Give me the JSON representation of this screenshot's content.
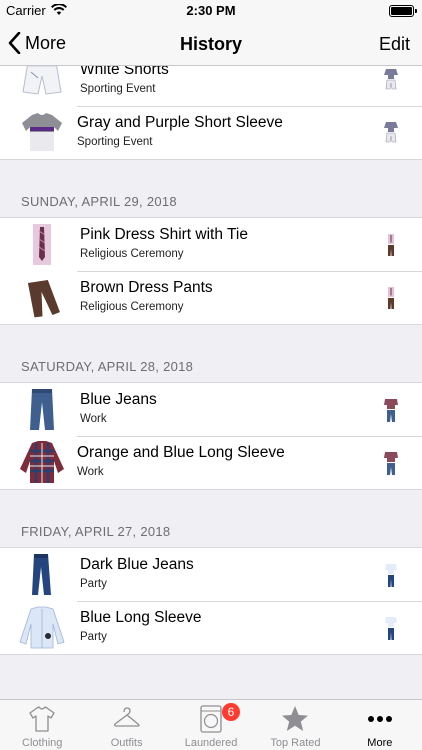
{
  "status_bar": {
    "carrier": "Carrier",
    "time": "2:30 PM"
  },
  "nav": {
    "back_label": "More",
    "title": "History",
    "edit_label": "Edit"
  },
  "groups": [
    {
      "header": "",
      "items": [
        {
          "title": "White Shorts",
          "subtitle": "Sporting Event",
          "thumb": "shorts"
        },
        {
          "title": "Gray and Purple Short Sleeve",
          "subtitle": "Sporting Event",
          "thumb": "tshirt"
        }
      ]
    },
    {
      "header": "SUNDAY, APRIL 29, 2018",
      "items": [
        {
          "title": "Pink Dress Shirt with Tie",
          "subtitle": "Religious Ceremony",
          "thumb": "dress-shirt"
        },
        {
          "title": "Brown Dress Pants",
          "subtitle": "Religious Ceremony",
          "thumb": "pants"
        }
      ]
    },
    {
      "header": "SATURDAY, APRIL 28, 2018",
      "items": [
        {
          "title": "Blue Jeans",
          "subtitle": "Work",
          "thumb": "jeans"
        },
        {
          "title": "Orange and Blue Long Sleeve",
          "subtitle": "Work",
          "thumb": "plaid-shirt"
        }
      ]
    },
    {
      "header": "FRIDAY, APRIL 27, 2018",
      "items": [
        {
          "title": "Dark Blue Jeans",
          "subtitle": "Party",
          "thumb": "dark-jeans"
        },
        {
          "title": "Blue Long Sleeve",
          "subtitle": "Party",
          "thumb": "long-sleeve"
        }
      ]
    }
  ],
  "tabs": [
    {
      "label": "Clothing",
      "icon": "tshirt-icon",
      "active": false
    },
    {
      "label": "Outfits",
      "icon": "hanger-icon",
      "active": false
    },
    {
      "label": "Laundered",
      "icon": "washer-icon",
      "active": false,
      "badge": "6"
    },
    {
      "label": "Top Rated",
      "icon": "star-icon",
      "active": false
    },
    {
      "label": "More",
      "icon": "more-icon",
      "active": true
    }
  ],
  "colors": {
    "accent": "#000000",
    "badge": "#ff3b30",
    "inactive": "#8e8e93"
  }
}
